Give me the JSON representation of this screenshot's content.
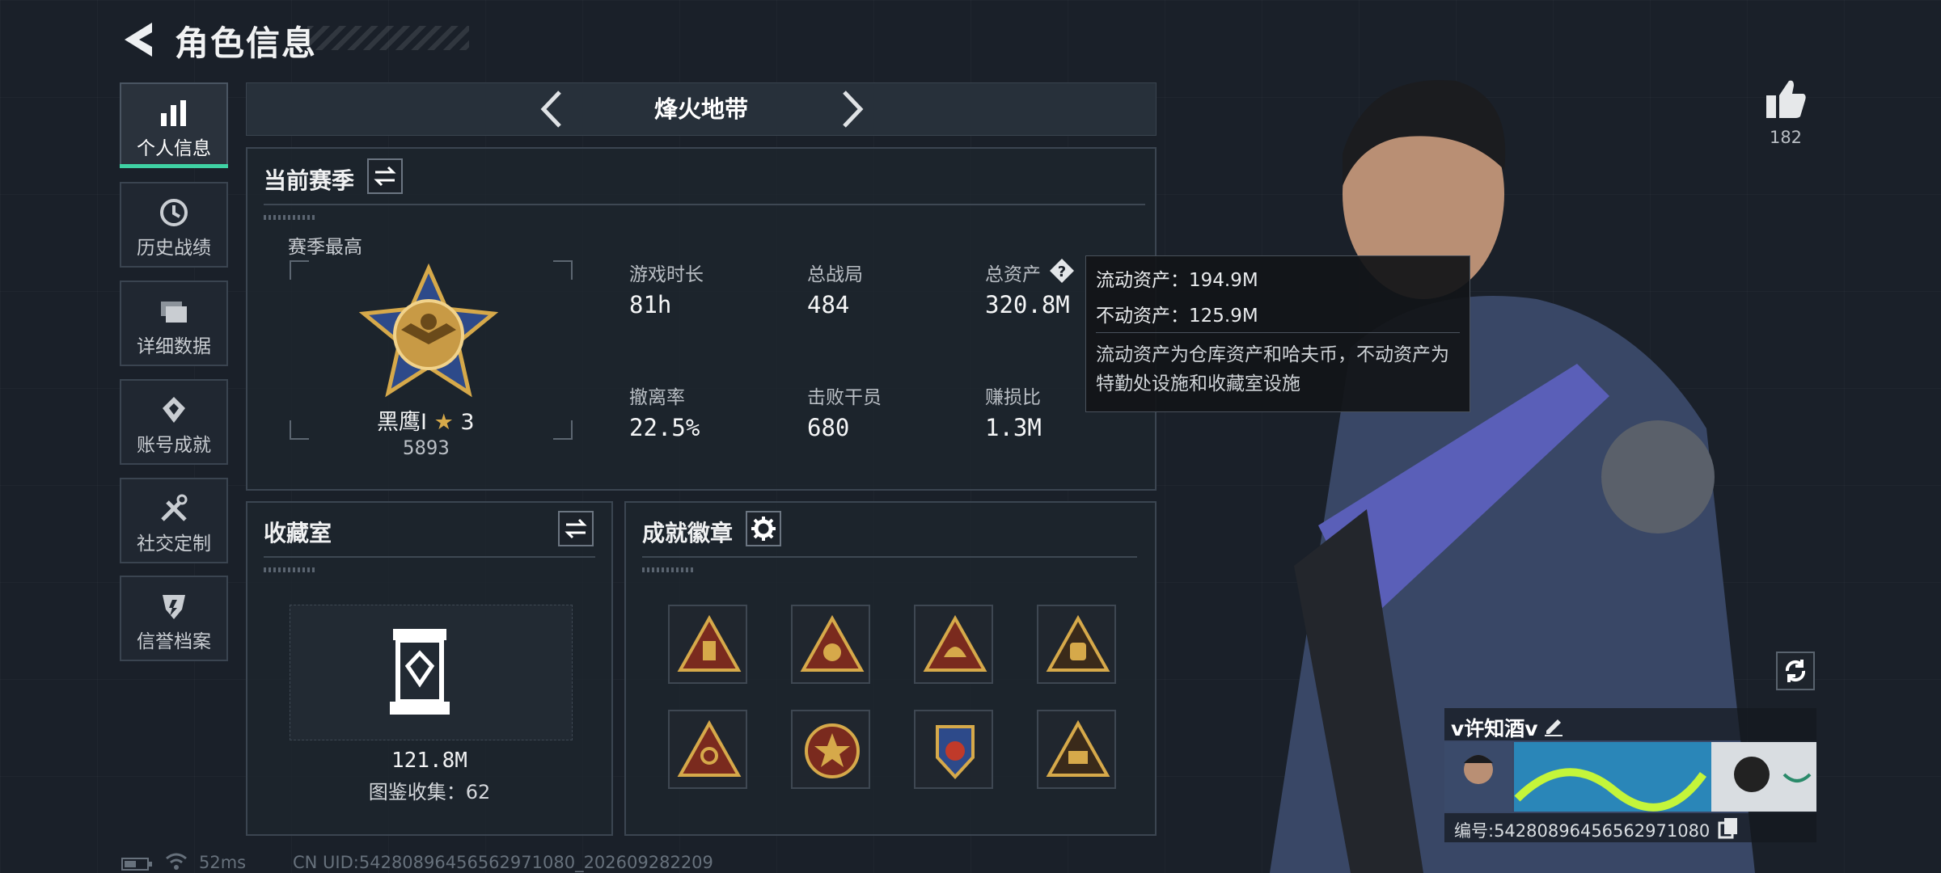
{
  "header": {
    "title": "角色信息"
  },
  "sidebar": {
    "items": [
      {
        "label": "个人信息",
        "icon": "bar-chart-icon",
        "active": true
      },
      {
        "label": "历史战绩",
        "icon": "history-clock-icon"
      },
      {
        "label": "详细数据",
        "icon": "folder-stack-icon"
      },
      {
        "label": "账号成就",
        "icon": "achievement-diamond-icon"
      },
      {
        "label": "社交定制",
        "icon": "tools-cross-icon"
      },
      {
        "label": "信誉档案",
        "icon": "credit-shield-icon"
      }
    ]
  },
  "mode": {
    "title": "烽火地带"
  },
  "season": {
    "title": "当前赛季",
    "best_label": "赛季最高",
    "rank_name": "黑鹰Ⅰ",
    "rank_stars": "3",
    "rank_score": "5893",
    "stats": [
      {
        "label": "游戏时长",
        "value": "81h"
      },
      {
        "label": "总战局",
        "value": "484"
      },
      {
        "label": "总资产",
        "value": "320.8M"
      },
      {
        "label": "撤离率",
        "value": "22.5%"
      },
      {
        "label": "击败干员",
        "value": "680"
      },
      {
        "label": "赚损比",
        "value": "1.3M"
      }
    ]
  },
  "tooltip": {
    "liquid": "流动资产：194.9M",
    "fixed": "不动资产：125.9M",
    "desc": "流动资产为仓库资产和哈夫币，不动资产为特勤处设施和收藏室设施"
  },
  "collection": {
    "title": "收藏室",
    "value": "121.8M",
    "count": "图鉴收集：62"
  },
  "badges": {
    "title": "成就徽章",
    "items": [
      "badge-icon-1",
      "badge-icon-2",
      "badge-icon-3",
      "badge-icon-4",
      "badge-icon-5",
      "badge-icon-6",
      "badge-icon-7",
      "badge-icon-8"
    ]
  },
  "likes": {
    "count": "182"
  },
  "player": {
    "name": "v许知酒v",
    "id": "编号:542808964565629710​80"
  },
  "status": {
    "ping": "52ms",
    "uid": "CN UID:542808964565629710​80_202609282209"
  },
  "colors": {
    "accent": "#3fd2a4",
    "badge_gold": "#d6a94a",
    "badge_red": "#7a2a1e"
  }
}
